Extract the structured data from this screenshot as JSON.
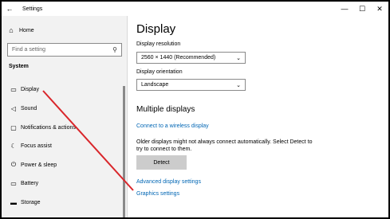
{
  "window": {
    "title": "Settings",
    "back_icon": "back-arrow-icon",
    "controls": {
      "minimize": "—",
      "maximize": "☐",
      "close": "✕"
    }
  },
  "sidebar": {
    "home": {
      "label": "Home",
      "icon": "home-icon"
    },
    "search": {
      "placeholder": "Find a setting",
      "icon": "search-icon"
    },
    "section": "System",
    "items": [
      {
        "label": "Display",
        "icon": "monitor-icon"
      },
      {
        "label": "Sound",
        "icon": "speaker-icon"
      },
      {
        "label": "Notifications & actions",
        "icon": "notification-icon"
      },
      {
        "label": "Focus assist",
        "icon": "moon-icon"
      },
      {
        "label": "Power & sleep",
        "icon": "power-icon"
      },
      {
        "label": "Battery",
        "icon": "battery-icon"
      },
      {
        "label": "Storage",
        "icon": "storage-icon"
      }
    ]
  },
  "main": {
    "title": "Display",
    "resolution": {
      "label": "Display resolution",
      "value": "2560 × 1440 (Recommended)"
    },
    "orientation": {
      "label": "Display orientation",
      "value": "Landscape"
    },
    "multiple_displays": {
      "heading": "Multiple displays",
      "connect_link": "Connect to a wireless display",
      "description": "Older displays might not always connect automatically. Select Detect to try to connect to them.",
      "detect_button": "Detect"
    },
    "advanced_link": "Advanced display settings",
    "graphics_link": "Graphics settings"
  },
  "colors": {
    "link": "#0066b4",
    "sidebar_bg": "#f2f2f2",
    "annotation": "#d9262b"
  }
}
